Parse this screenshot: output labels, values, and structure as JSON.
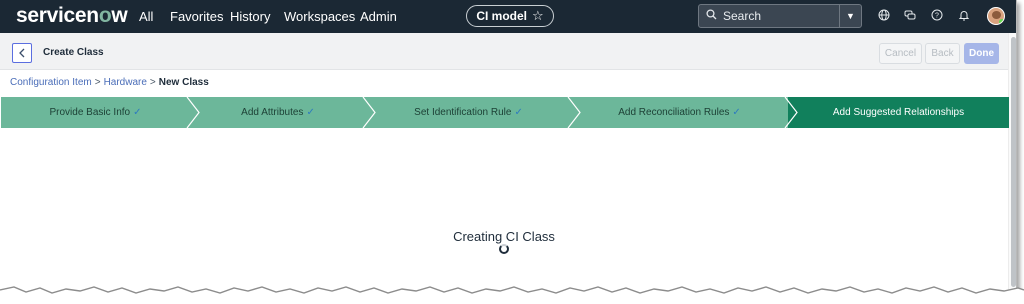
{
  "nav": {
    "logo": "servicenow",
    "items": [
      "All",
      "Favorites",
      "History",
      "Workspaces",
      "Admin"
    ],
    "context_pill": "CI model",
    "search_placeholder": "Search",
    "icons": [
      "globe-icon",
      "chat-icon",
      "help-icon",
      "bell-icon"
    ]
  },
  "header": {
    "title": "Create Class",
    "cancel_label": "Cancel",
    "back_label": "Back",
    "done_label": "Done"
  },
  "breadcrumb": {
    "items": [
      "Configuration Item",
      "Hardware"
    ],
    "separator": ">",
    "current": "New Class"
  },
  "steps": [
    {
      "label": "Provide Basic Info",
      "check": "✓"
    },
    {
      "label": "Add Attributes",
      "check": "✓"
    },
    {
      "label": "Set Identification Rule",
      "check": "✓"
    },
    {
      "label": "Add Reconciliation Rules",
      "check": "✓"
    },
    {
      "label": "Add Suggested Relationships",
      "check": ""
    }
  ],
  "status": {
    "loading_text": "Creating CI Class"
  },
  "colors": {
    "nav_bg": "#1b2834",
    "step_done": "#6cb79a",
    "step_active": "#11805c",
    "link": "#4a6db8"
  }
}
